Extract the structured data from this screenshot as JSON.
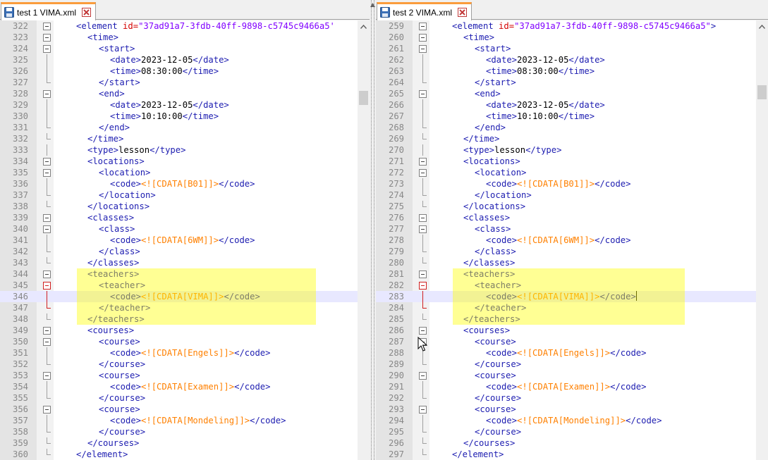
{
  "left": {
    "tab": {
      "label": "test 1 VIMA.xml"
    },
    "lines": [
      {
        "n": "322",
        "ind": 0,
        "segs": [
          [
            "t",
            "<element "
          ],
          [
            "a",
            "id="
          ],
          [
            "v",
            "\"37ad91a7-3fdb-40ff-9898-c5745c9466a5'"
          ]
        ],
        "fold": "box"
      },
      {
        "n": "323",
        "ind": 1,
        "segs": [
          [
            "t",
            "<time>"
          ]
        ],
        "fold": "box"
      },
      {
        "n": "324",
        "ind": 2,
        "segs": [
          [
            "t",
            "<start>"
          ]
        ],
        "fold": "box"
      },
      {
        "n": "325",
        "ind": 3,
        "segs": [
          [
            "t",
            "<date>"
          ],
          [
            "tx",
            "2023-12-05"
          ],
          [
            "t",
            "</date>"
          ]
        ],
        "fold": "line"
      },
      {
        "n": "326",
        "ind": 3,
        "segs": [
          [
            "t",
            "<time>"
          ],
          [
            "tx",
            "08:30:00"
          ],
          [
            "t",
            "</time>"
          ]
        ],
        "fold": "line"
      },
      {
        "n": "327",
        "ind": 2,
        "segs": [
          [
            "t",
            "</start>"
          ]
        ],
        "fold": "end"
      },
      {
        "n": "328",
        "ind": 2,
        "segs": [
          [
            "t",
            "<end>"
          ]
        ],
        "fold": "box"
      },
      {
        "n": "329",
        "ind": 3,
        "segs": [
          [
            "t",
            "<date>"
          ],
          [
            "tx",
            "2023-12-05"
          ],
          [
            "t",
            "</date>"
          ]
        ],
        "fold": "line"
      },
      {
        "n": "330",
        "ind": 3,
        "segs": [
          [
            "t",
            "<time>"
          ],
          [
            "tx",
            "10:10:00"
          ],
          [
            "t",
            "</time>"
          ]
        ],
        "fold": "line"
      },
      {
        "n": "331",
        "ind": 2,
        "segs": [
          [
            "t",
            "</end>"
          ]
        ],
        "fold": "end"
      },
      {
        "n": "332",
        "ind": 1,
        "segs": [
          [
            "t",
            "</time>"
          ]
        ],
        "fold": "end"
      },
      {
        "n": "333",
        "ind": 1,
        "segs": [
          [
            "t",
            "<type>"
          ],
          [
            "tx",
            "lesson"
          ],
          [
            "t",
            "</type>"
          ]
        ],
        "fold": "line"
      },
      {
        "n": "334",
        "ind": 1,
        "segs": [
          [
            "t",
            "<locations>"
          ]
        ],
        "fold": "box"
      },
      {
        "n": "335",
        "ind": 2,
        "segs": [
          [
            "t",
            "<location>"
          ]
        ],
        "fold": "box"
      },
      {
        "n": "336",
        "ind": 3,
        "segs": [
          [
            "t",
            "<code>"
          ],
          [
            "cd",
            "<![CDATA[B01]]>"
          ],
          [
            "t",
            "</code>"
          ]
        ],
        "fold": "line"
      },
      {
        "n": "337",
        "ind": 2,
        "segs": [
          [
            "t",
            "</location>"
          ]
        ],
        "fold": "end"
      },
      {
        "n": "338",
        "ind": 1,
        "segs": [
          [
            "t",
            "</locations>"
          ]
        ],
        "fold": "end"
      },
      {
        "n": "339",
        "ind": 1,
        "segs": [
          [
            "t",
            "<classes>"
          ]
        ],
        "fold": "box"
      },
      {
        "n": "340",
        "ind": 2,
        "segs": [
          [
            "t",
            "<class>"
          ]
        ],
        "fold": "box"
      },
      {
        "n": "341",
        "ind": 3,
        "segs": [
          [
            "t",
            "<code>"
          ],
          [
            "cd",
            "<![CDATA[6WM]]>"
          ],
          [
            "t",
            "</code>"
          ]
        ],
        "fold": "line"
      },
      {
        "n": "342",
        "ind": 2,
        "segs": [
          [
            "t",
            "</class>"
          ]
        ],
        "fold": "end"
      },
      {
        "n": "343",
        "ind": 1,
        "segs": [
          [
            "t",
            "</classes>"
          ]
        ],
        "fold": "end"
      },
      {
        "n": "344",
        "ind": 1,
        "segs": [
          [
            "t",
            "<teachers>"
          ]
        ],
        "fold": "box"
      },
      {
        "n": "345",
        "ind": 2,
        "segs": [
          [
            "t",
            "<teacher>"
          ]
        ],
        "fold": "boxred"
      },
      {
        "n": "346",
        "ind": 3,
        "segs": [
          [
            "t",
            "<code>"
          ],
          [
            "cd",
            "<![CDATA[VIMA]]>"
          ],
          [
            "t",
            "</code>"
          ]
        ],
        "fold": "linered",
        "current": true
      },
      {
        "n": "347",
        "ind": 2,
        "segs": [
          [
            "t",
            "</teacher>"
          ]
        ],
        "fold": "endred"
      },
      {
        "n": "348",
        "ind": 1,
        "segs": [
          [
            "t",
            "</teachers>"
          ]
        ],
        "fold": "end"
      },
      {
        "n": "349",
        "ind": 1,
        "segs": [
          [
            "t",
            "<courses>"
          ]
        ],
        "fold": "box"
      },
      {
        "n": "350",
        "ind": 2,
        "segs": [
          [
            "t",
            "<course>"
          ]
        ],
        "fold": "box"
      },
      {
        "n": "351",
        "ind": 3,
        "segs": [
          [
            "t",
            "<code>"
          ],
          [
            "cd",
            "<![CDATA[Engels]]>"
          ],
          [
            "t",
            "</code>"
          ]
        ],
        "fold": "line"
      },
      {
        "n": "352",
        "ind": 2,
        "segs": [
          [
            "t",
            "</course>"
          ]
        ],
        "fold": "end"
      },
      {
        "n": "353",
        "ind": 2,
        "segs": [
          [
            "t",
            "<course>"
          ]
        ],
        "fold": "box"
      },
      {
        "n": "354",
        "ind": 3,
        "segs": [
          [
            "t",
            "<code>"
          ],
          [
            "cd",
            "<![CDATA[Examen]]>"
          ],
          [
            "t",
            "</code>"
          ]
        ],
        "fold": "line"
      },
      {
        "n": "355",
        "ind": 2,
        "segs": [
          [
            "t",
            "</course>"
          ]
        ],
        "fold": "end"
      },
      {
        "n": "356",
        "ind": 2,
        "segs": [
          [
            "t",
            "<course>"
          ]
        ],
        "fold": "box"
      },
      {
        "n": "357",
        "ind": 3,
        "segs": [
          [
            "t",
            "<code>"
          ],
          [
            "cd",
            "<![CDATA[Mondeling]]>"
          ],
          [
            "t",
            "</code>"
          ]
        ],
        "fold": "line"
      },
      {
        "n": "358",
        "ind": 2,
        "segs": [
          [
            "t",
            "</course>"
          ]
        ],
        "fold": "end"
      },
      {
        "n": "359",
        "ind": 1,
        "segs": [
          [
            "t",
            "</courses>"
          ]
        ],
        "fold": "end"
      },
      {
        "n": "360",
        "ind": 0,
        "segs": [
          [
            "t",
            "</element>"
          ]
        ],
        "fold": "end"
      }
    ]
  },
  "right": {
    "tab": {
      "label": "test 2 VIMA.xml"
    },
    "lines": [
      {
        "n": "259",
        "ind": 0,
        "segs": [
          [
            "t",
            "<element "
          ],
          [
            "a",
            "id="
          ],
          [
            "v",
            "\"37ad91a7-3fdb-40ff-9898-c5745c9466a5\""
          ],
          [
            "t",
            ">"
          ]
        ],
        "fold": "box"
      },
      {
        "n": "260",
        "ind": 1,
        "segs": [
          [
            "t",
            "<time>"
          ]
        ],
        "fold": "box"
      },
      {
        "n": "261",
        "ind": 2,
        "segs": [
          [
            "t",
            "<start>"
          ]
        ],
        "fold": "box"
      },
      {
        "n": "262",
        "ind": 3,
        "segs": [
          [
            "t",
            "<date>"
          ],
          [
            "tx",
            "2023-12-05"
          ],
          [
            "t",
            "</date>"
          ]
        ],
        "fold": "line"
      },
      {
        "n": "263",
        "ind": 3,
        "segs": [
          [
            "t",
            "<time>"
          ],
          [
            "tx",
            "08:30:00"
          ],
          [
            "t",
            "</time>"
          ]
        ],
        "fold": "line"
      },
      {
        "n": "264",
        "ind": 2,
        "segs": [
          [
            "t",
            "</start>"
          ]
        ],
        "fold": "end"
      },
      {
        "n": "265",
        "ind": 2,
        "segs": [
          [
            "t",
            "<end>"
          ]
        ],
        "fold": "box"
      },
      {
        "n": "266",
        "ind": 3,
        "segs": [
          [
            "t",
            "<date>"
          ],
          [
            "tx",
            "2023-12-05"
          ],
          [
            "t",
            "</date>"
          ]
        ],
        "fold": "line"
      },
      {
        "n": "267",
        "ind": 3,
        "segs": [
          [
            "t",
            "<time>"
          ],
          [
            "tx",
            "10:10:00"
          ],
          [
            "t",
            "</time>"
          ]
        ],
        "fold": "line"
      },
      {
        "n": "268",
        "ind": 2,
        "segs": [
          [
            "t",
            "</end>"
          ]
        ],
        "fold": "end"
      },
      {
        "n": "269",
        "ind": 1,
        "segs": [
          [
            "t",
            "</time>"
          ]
        ],
        "fold": "end"
      },
      {
        "n": "270",
        "ind": 1,
        "segs": [
          [
            "t",
            "<type>"
          ],
          [
            "tx",
            "lesson"
          ],
          [
            "t",
            "</type>"
          ]
        ],
        "fold": "line"
      },
      {
        "n": "271",
        "ind": 1,
        "segs": [
          [
            "t",
            "<locations>"
          ]
        ],
        "fold": "box"
      },
      {
        "n": "272",
        "ind": 2,
        "segs": [
          [
            "t",
            "<location>"
          ]
        ],
        "fold": "box"
      },
      {
        "n": "273",
        "ind": 3,
        "segs": [
          [
            "t",
            "<code>"
          ],
          [
            "cd",
            "<![CDATA[B01]]>"
          ],
          [
            "t",
            "</code>"
          ]
        ],
        "fold": "line"
      },
      {
        "n": "274",
        "ind": 2,
        "segs": [
          [
            "t",
            "</location>"
          ]
        ],
        "fold": "end"
      },
      {
        "n": "275",
        "ind": 1,
        "segs": [
          [
            "t",
            "</locations>"
          ]
        ],
        "fold": "end"
      },
      {
        "n": "276",
        "ind": 1,
        "segs": [
          [
            "t",
            "<classes>"
          ]
        ],
        "fold": "box"
      },
      {
        "n": "277",
        "ind": 2,
        "segs": [
          [
            "t",
            "<class>"
          ]
        ],
        "fold": "box"
      },
      {
        "n": "278",
        "ind": 3,
        "segs": [
          [
            "t",
            "<code>"
          ],
          [
            "cd",
            "<![CDATA[6WM]]>"
          ],
          [
            "t",
            "</code>"
          ]
        ],
        "fold": "line"
      },
      {
        "n": "279",
        "ind": 2,
        "segs": [
          [
            "t",
            "</class>"
          ]
        ],
        "fold": "end"
      },
      {
        "n": "280",
        "ind": 1,
        "segs": [
          [
            "t",
            "</classes>"
          ]
        ],
        "fold": "end"
      },
      {
        "n": "281",
        "ind": 1,
        "segs": [
          [
            "t",
            "<teachers>"
          ]
        ],
        "fold": "box"
      },
      {
        "n": "282",
        "ind": 2,
        "segs": [
          [
            "t",
            "<teacher>"
          ]
        ],
        "fold": "boxred"
      },
      {
        "n": "283",
        "ind": 3,
        "segs": [
          [
            "t",
            "<code>"
          ],
          [
            "cd",
            "<![CDATA[VIMA]]>"
          ],
          [
            "t",
            "</code>"
          ]
        ],
        "fold": "linered",
        "current": true,
        "caret": true
      },
      {
        "n": "284",
        "ind": 2,
        "segs": [
          [
            "t",
            "</teacher>"
          ]
        ],
        "fold": "endred"
      },
      {
        "n": "285",
        "ind": 1,
        "segs": [
          [
            "t",
            "</teachers>"
          ]
        ],
        "fold": "end"
      },
      {
        "n": "286",
        "ind": 1,
        "segs": [
          [
            "t",
            "<courses>"
          ]
        ],
        "fold": "box"
      },
      {
        "n": "287",
        "ind": 2,
        "segs": [
          [
            "t",
            "<course>"
          ]
        ],
        "fold": "box"
      },
      {
        "n": "288",
        "ind": 3,
        "segs": [
          [
            "t",
            "<code>"
          ],
          [
            "cd",
            "<![CDATA[Engels]]>"
          ],
          [
            "t",
            "</code>"
          ]
        ],
        "fold": "line"
      },
      {
        "n": "289",
        "ind": 2,
        "segs": [
          [
            "t",
            "</course>"
          ]
        ],
        "fold": "end"
      },
      {
        "n": "290",
        "ind": 2,
        "segs": [
          [
            "t",
            "<course>"
          ]
        ],
        "fold": "box"
      },
      {
        "n": "291",
        "ind": 3,
        "segs": [
          [
            "t",
            "<code>"
          ],
          [
            "cd",
            "<![CDATA[Examen]]>"
          ],
          [
            "t",
            "</code>"
          ]
        ],
        "fold": "line"
      },
      {
        "n": "292",
        "ind": 2,
        "segs": [
          [
            "t",
            "</course>"
          ]
        ],
        "fold": "end"
      },
      {
        "n": "293",
        "ind": 2,
        "segs": [
          [
            "t",
            "<course>"
          ]
        ],
        "fold": "box"
      },
      {
        "n": "294",
        "ind": 3,
        "segs": [
          [
            "t",
            "<code>"
          ],
          [
            "cd",
            "<![CDATA[Mondeling]]>"
          ],
          [
            "t",
            "</code>"
          ]
        ],
        "fold": "line"
      },
      {
        "n": "295",
        "ind": 2,
        "segs": [
          [
            "t",
            "</course>"
          ]
        ],
        "fold": "end"
      },
      {
        "n": "296",
        "ind": 1,
        "segs": [
          [
            "t",
            "</courses>"
          ]
        ],
        "fold": "end"
      },
      {
        "n": "297",
        "ind": 0,
        "segs": [
          [
            "t",
            "</element>"
          ]
        ],
        "fold": "end"
      }
    ]
  },
  "colors": {
    "tag": "#1c1cb0",
    "attribute": "#d40000",
    "attribute_value": "#8000ff",
    "text": "#000000",
    "cdata": "#ff8000",
    "diff_highlight": "#ffff80",
    "current_line": "#e8e8ff",
    "tab_accent": "#fa9c3c"
  },
  "icons": {
    "tab_file": "save-disk-icon",
    "tab_close": "close-icon",
    "fold": "fold-minus-icon",
    "cursor": "mouse-pointer-icon"
  }
}
